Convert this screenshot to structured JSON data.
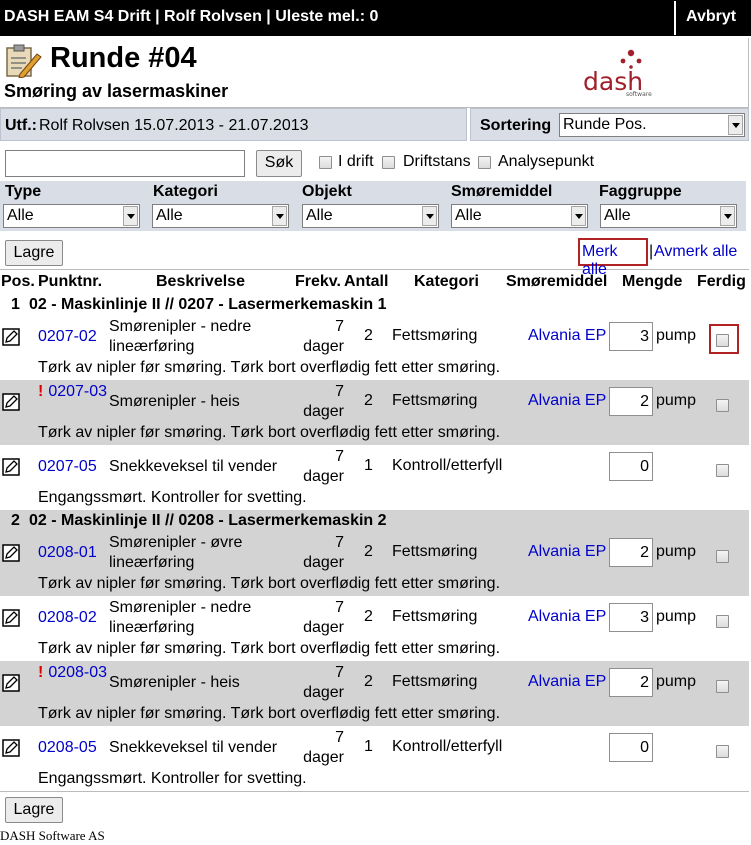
{
  "app": {
    "title": "DASH EAM S4 Drift | Rolf Rolvsen | Uleste mel.: 0",
    "abort_label": "Avbryt"
  },
  "header": {
    "title": "Runde #04",
    "subtitle": "Smøring av lasermaskiner",
    "logo_text": "dash",
    "logo_sub": "software"
  },
  "info": {
    "utf_label": "Utf.:",
    "utf_value": "Rolf Rolvsen 15.07.2013 - 21.07.2013",
    "sort_label": "Sortering",
    "sort_value": "Runde Pos."
  },
  "search": {
    "value": "",
    "button": "Søk"
  },
  "checks": {
    "idrift": "I drift",
    "driftstans": "Driftstans",
    "analysepunkt": "Analysepunkt"
  },
  "filters": [
    {
      "label": "Type",
      "value": "Alle"
    },
    {
      "label": "Kategori",
      "value": "Alle"
    },
    {
      "label": "Objekt",
      "value": "Alle"
    },
    {
      "label": "Smøremiddel",
      "value": "Alle"
    },
    {
      "label": "Faggruppe",
      "value": "Alle"
    }
  ],
  "actions": {
    "save": "Lagre",
    "mark_all": "Merk alle",
    "divider": "|",
    "unmark_all": "Avmerk alle"
  },
  "columns": {
    "pos": "Pos.",
    "punktnr": "Punktnr.",
    "beskrivelse": "Beskrivelse",
    "frekv": "Frekv.",
    "antall": "Antall",
    "kategori": "Kategori",
    "smoremiddel": "Smøremiddel",
    "mengde": "Mengde",
    "ferdig": "Ferdig"
  },
  "groups": [
    {
      "num": "1",
      "title": "02 - Maskinlinje II // 0207 - Lasermerkemaskin 1",
      "rows": [
        {
          "punktnr": "0207-02",
          "warn": false,
          "desc": "Smørenipler - nedre lineærføring",
          "frek_num": "7",
          "frek_unit": "dager",
          "antall": "2",
          "kategori": "Fettsmøring",
          "smoremiddel": "Alvania EP",
          "mengde": "3",
          "unit": "pump",
          "note": "Tørk av nipler før smøring. Tørk bort overflødig fett etter smøring."
        },
        {
          "punktnr": "0207-03",
          "warn": true,
          "desc": "Smørenipler - heis",
          "frek_num": "7",
          "frek_unit": "dager",
          "antall": "2",
          "kategori": "Fettsmøring",
          "smoremiddel": "Alvania EP",
          "mengde": "2",
          "unit": "pump",
          "note": "Tørk av nipler før smøring. Tørk bort overflødig fett etter smøring."
        },
        {
          "punktnr": "0207-05",
          "warn": false,
          "desc": "Snekkeveksel til vender",
          "frek_num": "7",
          "frek_unit": "dager",
          "antall": "1",
          "kategori": "Kontroll/etterfyll",
          "smoremiddel": "",
          "mengde": "0",
          "unit": "",
          "note": "Engangssmørt. Kontroller for svetting."
        }
      ]
    },
    {
      "num": "2",
      "title": "02 - Maskinlinje II // 0208 - Lasermerkemaskin 2",
      "rows": [
        {
          "punktnr": "0208-01",
          "warn": false,
          "desc": "Smørenipler - øvre lineærføring",
          "frek_num": "7",
          "frek_unit": "dager",
          "antall": "2",
          "kategori": "Fettsmøring",
          "smoremiddel": "Alvania EP",
          "mengde": "2",
          "unit": "pump",
          "note": "Tørk av nipler før smøring. Tørk bort overflødig fett etter smøring."
        },
        {
          "punktnr": "0208-02",
          "warn": false,
          "desc": "Smørenipler - nedre lineærføring",
          "frek_num": "7",
          "frek_unit": "dager",
          "antall": "2",
          "kategori": "Fettsmøring",
          "smoremiddel": "Alvania EP",
          "mengde": "3",
          "unit": "pump",
          "note": "Tørk av nipler før smøring. Tørk bort overflødig fett etter smøring."
        },
        {
          "punktnr": "0208-03",
          "warn": true,
          "desc": "Smørenipler - heis",
          "frek_num": "7",
          "frek_unit": "dager",
          "antall": "2",
          "kategori": "Fettsmøring",
          "smoremiddel": "Alvania EP",
          "mengde": "2",
          "unit": "pump",
          "note": "Tørk av nipler før smøring. Tørk bort overflødig fett etter smøring."
        },
        {
          "punktnr": "0208-05",
          "warn": false,
          "desc": "Snekkeveksel til vender",
          "frek_num": "7",
          "frek_unit": "dager",
          "antall": "1",
          "kategori": "Kontroll/etterfyll",
          "smoremiddel": "",
          "mengde": "0",
          "unit": "",
          "note": "Engangssmørt. Kontroller for svetting."
        }
      ]
    }
  ],
  "footer": {
    "text": "DASH Software AS"
  },
  "colors": {
    "accent_link": "#0000cc",
    "panel_bg": "#d8dde6",
    "row_alt": "#d3d3d3",
    "highlight": "#b22222",
    "logo_red": "#a0202c"
  }
}
